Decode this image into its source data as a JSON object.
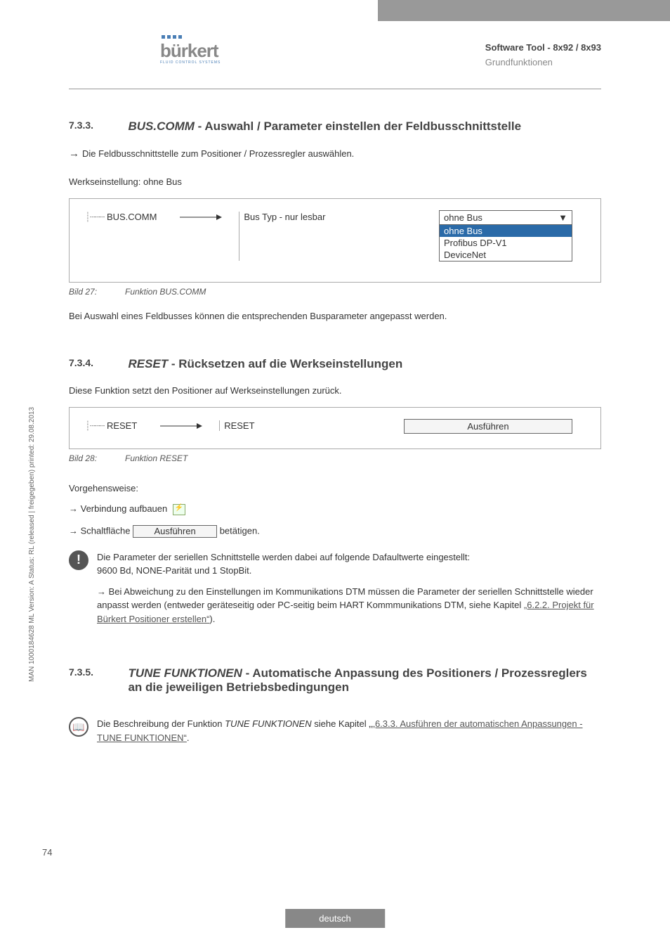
{
  "header": {
    "logo_text": "bürkert",
    "logo_sub": "FLUID CONTROL SYSTEMS",
    "doc_title": "Software Tool - 8x92 / 8x93",
    "doc_sub": "Grundfunktionen"
  },
  "section_733": {
    "num": "7.3.3.",
    "title_italic": "BUS.COMM",
    "title_rest": " - Auswahl / Parameter einstellen der Feldbusschnittstelle",
    "p1": "Die Feldbusschnittstelle zum Positioner / Prozessregler auswählen.",
    "p2": "Werkseinstellung: ohne Bus",
    "box": {
      "tree_label": "BUS.COMM",
      "field_label": "Bus Typ - nur lesbar",
      "dropdown": {
        "selected": "ohne Bus",
        "options": [
          "ohne Bus",
          "Profibus DP-V1",
          "DeviceNet"
        ]
      }
    },
    "caption_label": "Bild 27:",
    "caption_text": "Funktion BUS.COMM",
    "p3": "Bei Auswahl eines Feldbusses können die entsprechenden Busparameter angepasst werden."
  },
  "section_734": {
    "num": "7.3.4.",
    "title_italic": "RESET",
    "title_rest": " - Rücksetzen auf die Werkseinstellungen",
    "p1": "Diese Funktion setzt den Positioner auf Werkseinstellungen zurück.",
    "box": {
      "tree_label": "RESET",
      "field_label": "RESET",
      "button": "Ausführen"
    },
    "caption_label": "Bild 28:",
    "caption_text": "Funktion RESET",
    "proc_heading": "Vorgehensweise:",
    "proc_step1": "Verbindung aufbauen",
    "proc_step2a": "Schaltfläche",
    "proc_step2_btn": "Ausführen",
    "proc_step2b": "betätigen.",
    "note1_line1": "Die Parameter der seriellen Schnittstelle werden dabei auf folgende Dafaultwerte eingestellt:",
    "note1_line2": "9600 Bd, NONE-Parität und 1 StopBit.",
    "note1_sub": "Bei Abweichung zu den Einstellungen im Kommunikations DTM müssen die Parameter der seriellen Schnittstelle wieder anpasst werden (entweder geräteseitig oder PC-seitig beim HART Kommmunikations DTM, siehe Kapitel ",
    "note1_link": "„6.2.2. Projekt für Bürkert Positioner erstellen“",
    "note1_after": ")."
  },
  "section_735": {
    "num": "7.3.5.",
    "title_italic": "TUNE FUNKTIONEN",
    "title_rest": " - Automatische Anpassung des Positioners / Prozessreglers an die jeweiligen Betriebsbedingungen",
    "note_pre": "Die Beschreibung der Funktion ",
    "note_italic": "TUNE FUNKTIONEN",
    "note_mid": " siehe Kapitel „",
    "note_link": "„6.3.3. Ausführen der automatischen Anpassungen  - TUNE FUNKTIONEN“",
    "note_after": "."
  },
  "side_text": "MAN 1000184628 ML Version: A Status: RL (released | freigegeben) printed: 29.08.2013",
  "page_number": "74",
  "footer_lang": "deutsch"
}
